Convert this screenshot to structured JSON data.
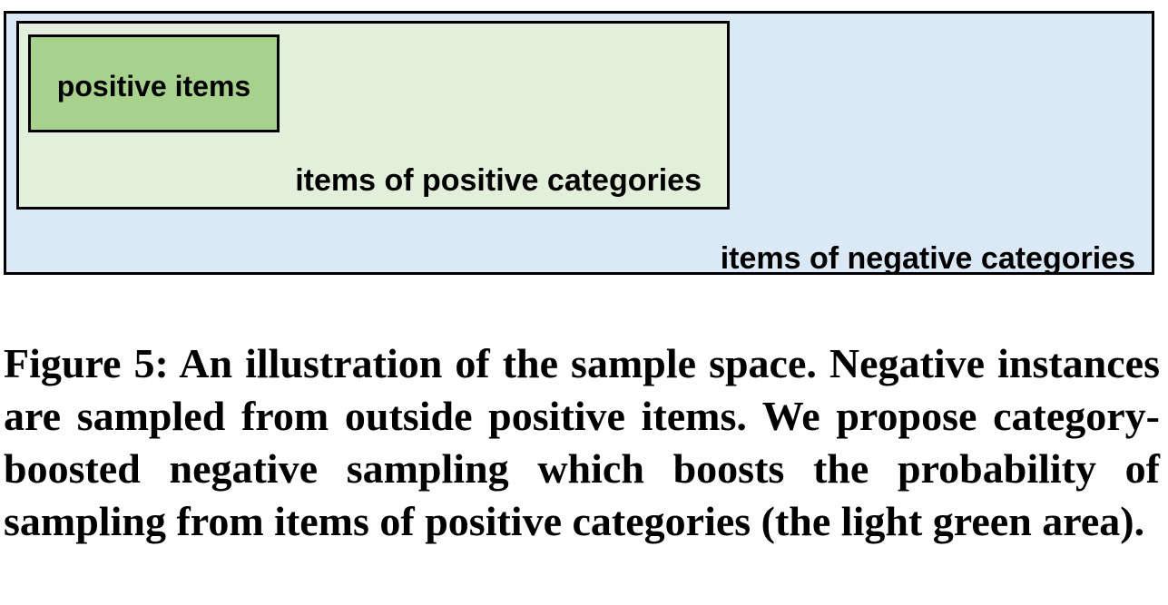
{
  "diagram": {
    "outer_label": "items of negative categories",
    "middle_label": "items of positive categories",
    "inner_label": "positive items",
    "colors": {
      "outer_fill": "#dbe8f6",
      "middle_fill": "#e2efda",
      "inner_fill": "#a9d18e",
      "border": "#000000"
    }
  },
  "caption": {
    "text": "Figure 5: An illustration of the sample space. Negative in­stances are sampled from outside positive items. We propose category-boosted negative sampling which boosts the prob­ability of sampling from items of positive categories (the light green area)."
  }
}
